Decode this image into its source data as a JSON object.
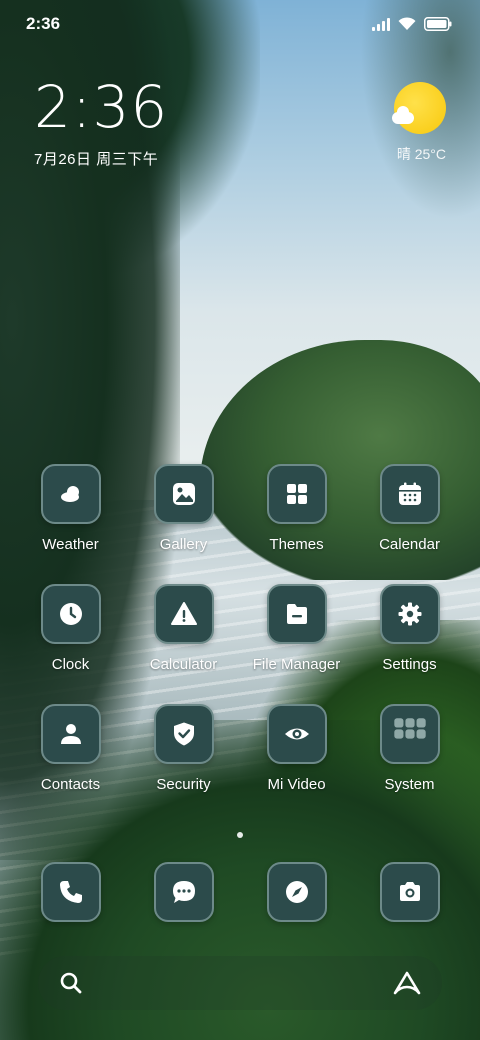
{
  "status_bar": {
    "time": "2:36",
    "signal_icon": "signal-icon",
    "wifi_icon": "wifi-icon",
    "battery_icon": "battery-icon"
  },
  "clock_widget": {
    "time": "2:36",
    "date": "7月26日 周三下午"
  },
  "weather_widget": {
    "icon": "sun-with-cloud-icon",
    "text": "晴 25°C",
    "sun_color": "#f8c80c"
  },
  "apps": [
    {
      "label": "Weather",
      "icon": "weather-icon"
    },
    {
      "label": "Gallery",
      "icon": "gallery-icon"
    },
    {
      "label": "Themes",
      "icon": "themes-icon"
    },
    {
      "label": "Calendar",
      "icon": "calendar-icon"
    },
    {
      "label": "Clock",
      "icon": "clock-icon"
    },
    {
      "label": "Calculator",
      "icon": "calculator-icon"
    },
    {
      "label": "File Manager",
      "icon": "file-manager-icon"
    },
    {
      "label": "Settings",
      "icon": "settings-icon"
    },
    {
      "label": "Contacts",
      "icon": "contacts-icon"
    },
    {
      "label": "Security",
      "icon": "security-icon"
    },
    {
      "label": "Mi Video",
      "icon": "mi-video-icon"
    },
    {
      "label": "System",
      "icon": "system-folder-icon"
    }
  ],
  "page_indicator": {
    "pages": 1,
    "current": 1
  },
  "dock": [
    {
      "name": "Phone",
      "icon": "phone-icon"
    },
    {
      "name": "Messages",
      "icon": "messages-icon"
    },
    {
      "name": "Browser",
      "icon": "compass-icon"
    },
    {
      "name": "Camera",
      "icon": "camera-icon"
    }
  ],
  "search_bar": {
    "left_icon": "search-icon",
    "right_icon": "assistant-icon"
  },
  "colors": {
    "icon_background": "#2c4b4b",
    "icon_border": "#6d8a89"
  }
}
